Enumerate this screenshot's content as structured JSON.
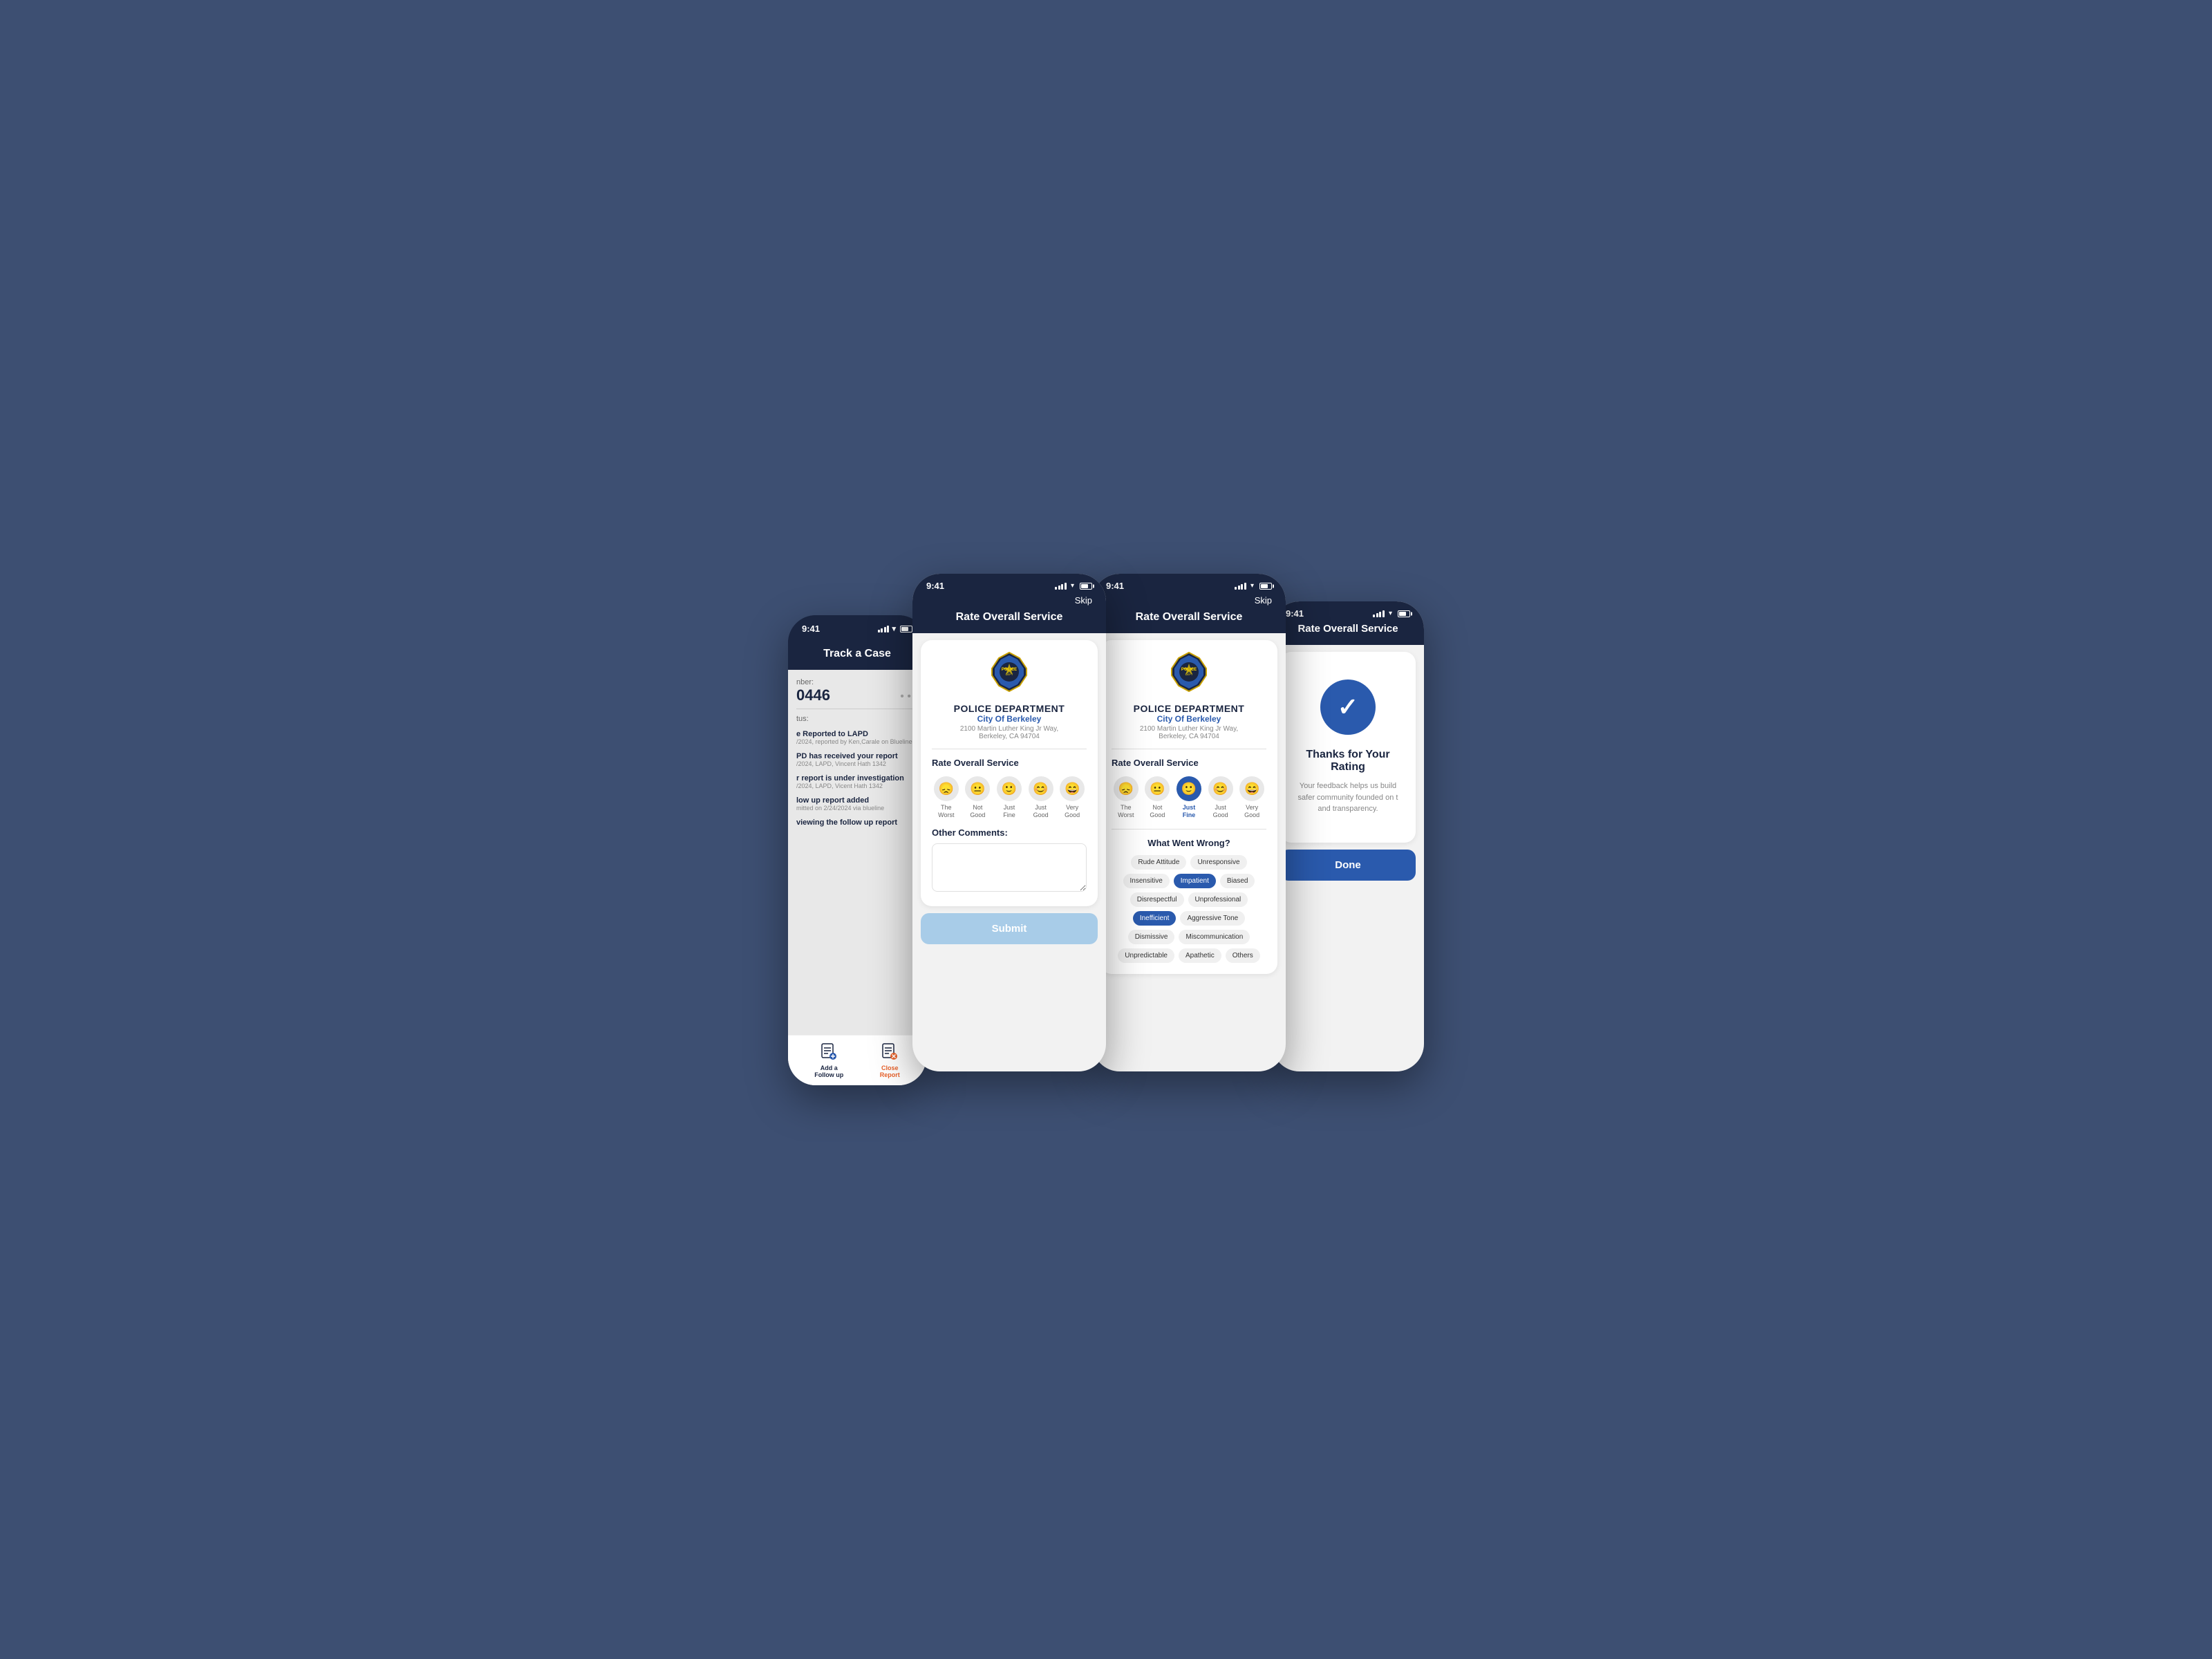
{
  "background_color": "#3d4f72",
  "screens": {
    "phone1": {
      "status_bar": {
        "time": "9:41"
      },
      "header": {
        "title": "Track a Case"
      },
      "case": {
        "number_label": "nber:",
        "number": "0446",
        "status_label": "tus:",
        "timeline": [
          {
            "title": "e Reported to LAPD",
            "sub": "/2024, reported by Ken,Carale on Blueline"
          },
          {
            "title": "PD has received your report",
            "sub": "/2024, LAPD, Vincent Hath  1342"
          },
          {
            "title": "r report is under investigation",
            "sub": "/2024, LAPD, Vicent Hath 1342"
          },
          {
            "title": "low up report added",
            "sub": "mitted on 2/24/2024 via blueline"
          },
          {
            "title": "viewing the follow up report",
            "sub": ""
          }
        ]
      },
      "footer": {
        "add_followup": "Add a\nFollow up",
        "close_report": "Close\nReport"
      }
    },
    "phone2": {
      "status_bar": {
        "time": "9:41"
      },
      "nav": {
        "skip": "Skip"
      },
      "header": {
        "title": "Rate Overall Service"
      },
      "card": {
        "dept_name": "POLICE DEPARTMENT",
        "dept_city": "City Of Berkeley",
        "dept_address": "2100 Martin Luther King Jr Way,\nBerkeley, CA 94704",
        "rating_title": "Rate Overall Service",
        "ratings": [
          {
            "label": "The\nWorst",
            "face": "😞",
            "selected": false
          },
          {
            "label": "Not\nGood",
            "face": "😐",
            "selected": false
          },
          {
            "label": "Just\nFine",
            "face": "🙂",
            "selected": false
          },
          {
            "label": "Just\nGood",
            "face": "😊",
            "selected": false
          },
          {
            "label": "Very\nGood",
            "face": "😄",
            "selected": false
          }
        ],
        "comments_label": "Other Comments:",
        "submit_label": "Submit"
      }
    },
    "phone3": {
      "status_bar": {
        "time": "9:41"
      },
      "nav": {
        "skip": "Skip"
      },
      "header": {
        "title": "Rate Overall Service"
      },
      "card": {
        "dept_name": "POLICE DEPARTMENT",
        "dept_city": "City Of Berkeley",
        "dept_address": "2100 Martin Luther King Jr Way,\nBerkeley, CA 94704",
        "rating_title": "Rate Overall Service",
        "ratings": [
          {
            "label": "The\nWorst",
            "face": "😞",
            "selected": false
          },
          {
            "label": "Not\nGood",
            "face": "😐",
            "selected": false
          },
          {
            "label": "Just\nFine",
            "face": "🙂",
            "selected": true
          },
          {
            "label": "Just\nGood",
            "face": "😊",
            "selected": false
          },
          {
            "label": "Very\nGood",
            "face": "😄",
            "selected": false
          }
        ],
        "wrong_title": "What Went Wrong?",
        "tags": [
          {
            "label": "Rude Attitude",
            "selected": false
          },
          {
            "label": "Unresponsive",
            "selected": false
          },
          {
            "label": "Insensitive",
            "selected": false
          },
          {
            "label": "Impatient",
            "selected": true
          },
          {
            "label": "Biased",
            "selected": false
          },
          {
            "label": "Disrespectful",
            "selected": false
          },
          {
            "label": "Unprofessional",
            "selected": false
          },
          {
            "label": "Inefficient",
            "selected": true
          },
          {
            "label": "Aggressive Tone",
            "selected": false
          },
          {
            "label": "Dismissive",
            "selected": false
          },
          {
            "label": "Miscommunication",
            "selected": false
          },
          {
            "label": "Unpredictable",
            "selected": false
          },
          {
            "label": "Apathetic",
            "selected": false
          },
          {
            "label": "Others",
            "selected": false
          }
        ]
      }
    },
    "phone4": {
      "status_bar": {
        "time": "9:41"
      },
      "header": {
        "title": "Rate Overall Service"
      },
      "thanks": {
        "title": "Thanks for Your Rating",
        "description": "Your feedback helps us build\nsafer community founded on t\nand transparency."
      },
      "done_label": "Done"
    }
  }
}
